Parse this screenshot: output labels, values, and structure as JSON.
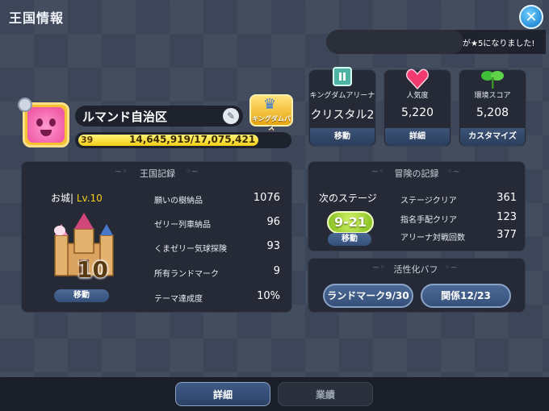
{
  "header": {
    "title": "王国情報",
    "close_icon": "close-icon"
  },
  "notice": {
    "text": "が★5になりました!"
  },
  "profile": {
    "kingdom_name": "ルマンド自治区",
    "level": "39",
    "exp_text": "14,645,919/17,075,421",
    "exp_progress": 0.858,
    "badge_label": "キングダムパス"
  },
  "stats": [
    {
      "label": "キングダムアリーナ",
      "value": "クリスタル2",
      "button": "移動",
      "icon": "arena-banner-icon"
    },
    {
      "label": "人気度",
      "value": "5,220",
      "button": "詳細",
      "icon": "heart-icon"
    },
    {
      "label": "環境スコア",
      "value": "5,208",
      "button": "カスタマイズ",
      "icon": "sprout-icon"
    }
  ],
  "kingdom_record": {
    "title": "王国記録",
    "castle_label": "お城",
    "castle_level": "Lv.10",
    "castle_big_level": "10",
    "move_button": "移動",
    "rows": [
      {
        "label": "願いの樹納品",
        "value": "1076"
      },
      {
        "label": "ゼリー列車納品",
        "value": "96"
      },
      {
        "label": "くまゼリー気球探険",
        "value": "93"
      },
      {
        "label": "所有ランドマーク",
        "value": "9"
      },
      {
        "label": "テーマ達成度",
        "value": "10%"
      }
    ]
  },
  "adventure_record": {
    "title": "冒険の記録",
    "next_stage_label": "次のステージ",
    "next_stage": "9-21",
    "move_button": "移動",
    "rows": [
      {
        "label": "ステージクリア",
        "value": "361"
      },
      {
        "label": "指名手配クリア",
        "value": "123"
      },
      {
        "label": "アリーナ対戦回数",
        "value": "377"
      }
    ]
  },
  "buffs": {
    "title": "活性化バフ",
    "landmark": "ランドマーク9/30",
    "relation": "関係12/23"
  },
  "tabs": {
    "detail": "詳細",
    "achievement": "業績"
  },
  "colors": {
    "accent": "#f3cf16",
    "button": "#34507a",
    "stage": "#8fc72a"
  }
}
